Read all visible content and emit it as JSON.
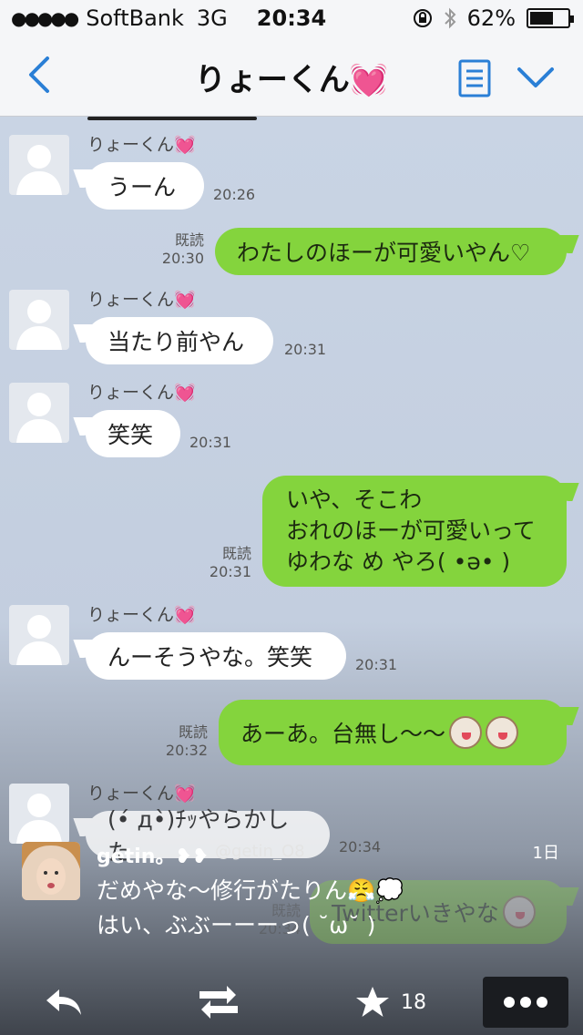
{
  "status": {
    "carrier": "SoftBank",
    "network": "3G",
    "time": "20:34",
    "battery": "62%",
    "battery_fraction": 0.62
  },
  "nav": {
    "title": "りょーくん💓"
  },
  "messages": {
    "m1": {
      "sender": "りょーくん💓",
      "text": "うーん",
      "time": "20:26"
    },
    "m2": {
      "read": "既読",
      "time": "20:30",
      "text": "わたしのほーが可愛いやん♡"
    },
    "m3": {
      "sender": "りょーくん💓",
      "text": "当たり前やん",
      "time": "20:31"
    },
    "m4": {
      "sender": "りょーくん💓",
      "text": "笑笑",
      "time": "20:31"
    },
    "m5": {
      "read": "既読",
      "time": "20:31",
      "lines": [
        "いや、そこわ",
        "おれのほーが可愛いって",
        "ゆわな め やろ( •ə• )"
      ]
    },
    "m6": {
      "sender": "りょーくん💓",
      "text": "んーそうやな。笑笑",
      "time": "20:31"
    },
    "m7": {
      "read": "既読",
      "time": "20:32",
      "text": "あーあ。台無し〜〜"
    },
    "m8": {
      "sender": "りょーくん💓",
      "text": "(•́ д•̀)ﾁｯやらかした",
      "time": "20:34"
    },
    "m9": {
      "read": "既読",
      "time": "20:34",
      "text": "Twitterいきやな"
    }
  },
  "tweet": {
    "name": "getin。❥❥",
    "handle": "@getin_O8",
    "ago": "1日",
    "line1": "だめやな〜修行がたりん😤💭",
    "line2": "はい、ぶぶーーーっ( ˘ω˘ )",
    "fav_count": "18"
  },
  "icons": {
    "back": "back-chevron-icon",
    "list": "note-list-icon",
    "menu": "chevron-down-icon",
    "reply": "reply-icon",
    "retweet": "retweet-icon",
    "favorite": "star-icon",
    "more": "more-dots-icon"
  },
  "colors": {
    "accent": "#2a7fd6",
    "out_bubble": "#84d43d",
    "in_bubble": "#ffffff"
  }
}
